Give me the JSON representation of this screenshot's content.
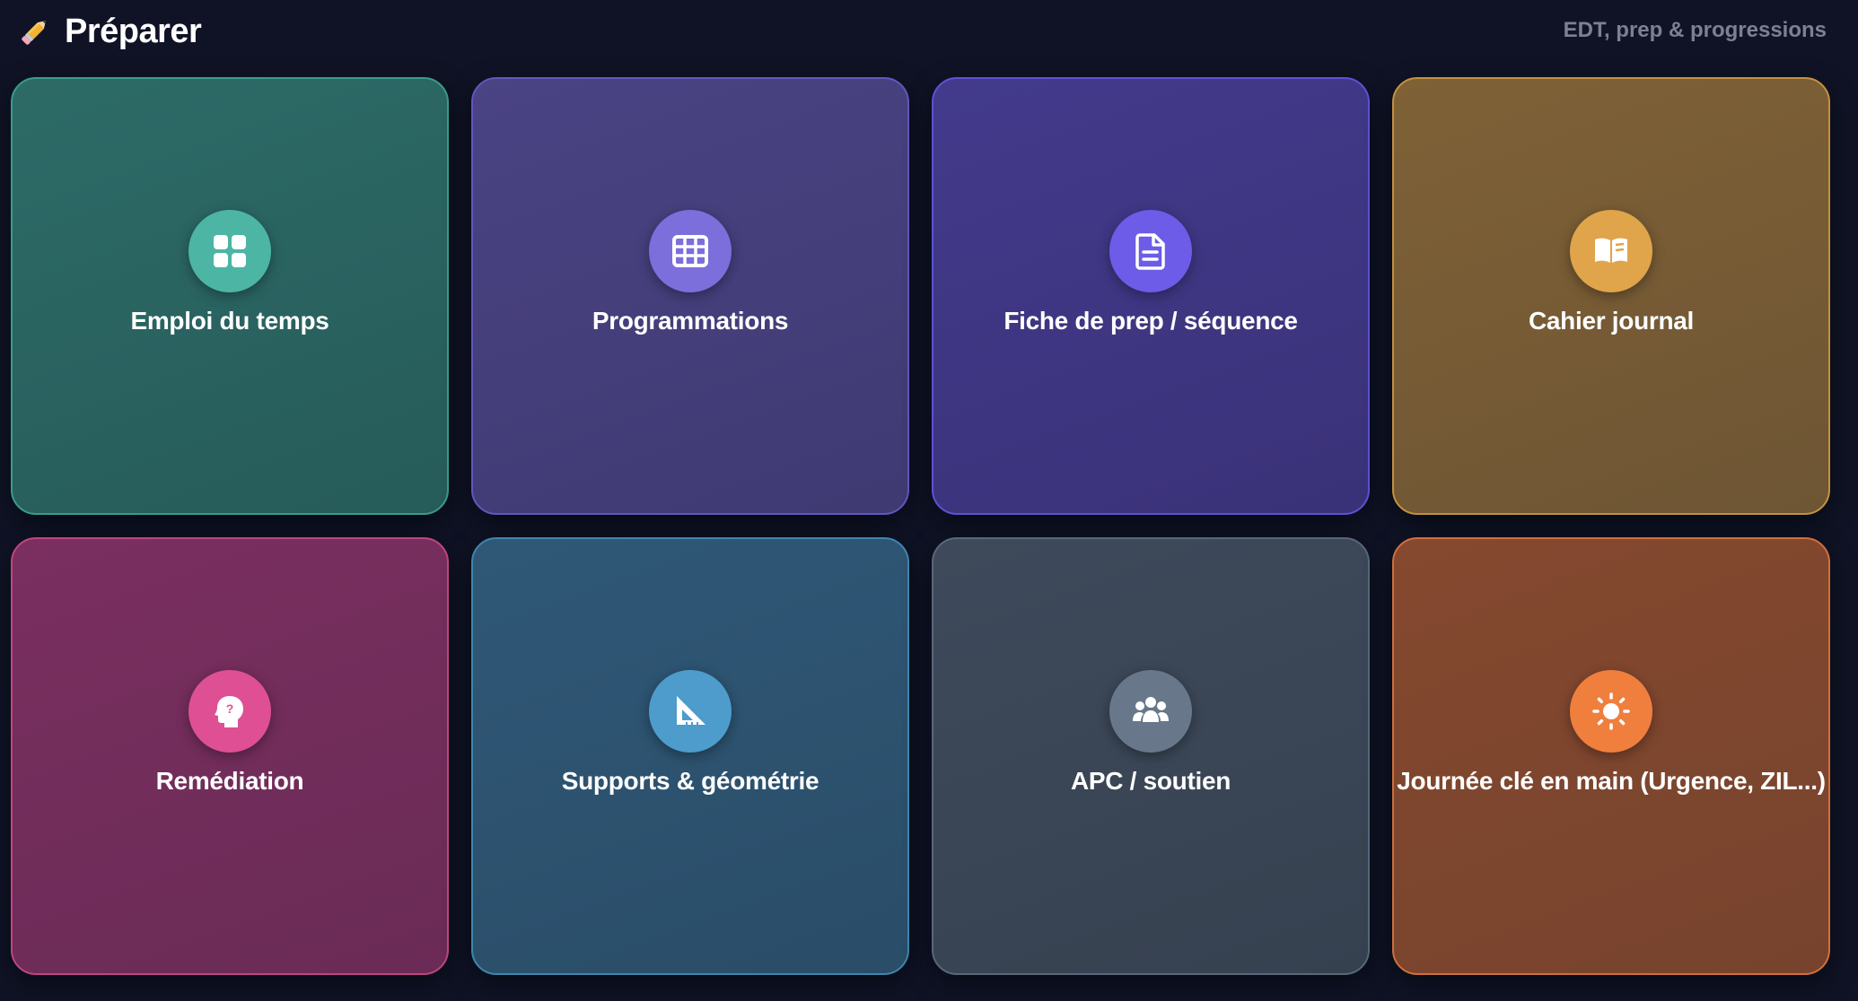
{
  "header": {
    "title": "Préparer",
    "title_icon": "pencil-icon",
    "subtitle": "EDT, prep & progressions"
  },
  "tiles": [
    {
      "label": "Emploi du temps",
      "icon": "grid-icon",
      "color": "#4cb5a4"
    },
    {
      "label": "Programmations",
      "icon": "table-icon",
      "color": "#7c6fdb"
    },
    {
      "label": "Fiche de prep / séquence",
      "icon": "document-icon",
      "color": "#6c5ce7"
    },
    {
      "label": "Cahier journal",
      "icon": "open-book-icon",
      "color": "#e0a44a"
    },
    {
      "label": "Remédiation",
      "icon": "head-question-icon",
      "color": "#de4f94"
    },
    {
      "label": "Supports & géométrie",
      "icon": "set-square-icon",
      "color": "#4d9ccc"
    },
    {
      "label": "APC / soutien",
      "icon": "group-icon",
      "color": "#68778a"
    },
    {
      "label": "Journée clé en main (Urgence, ZIL...)",
      "icon": "sun-icon",
      "color": "#f07f3e"
    }
  ]
}
